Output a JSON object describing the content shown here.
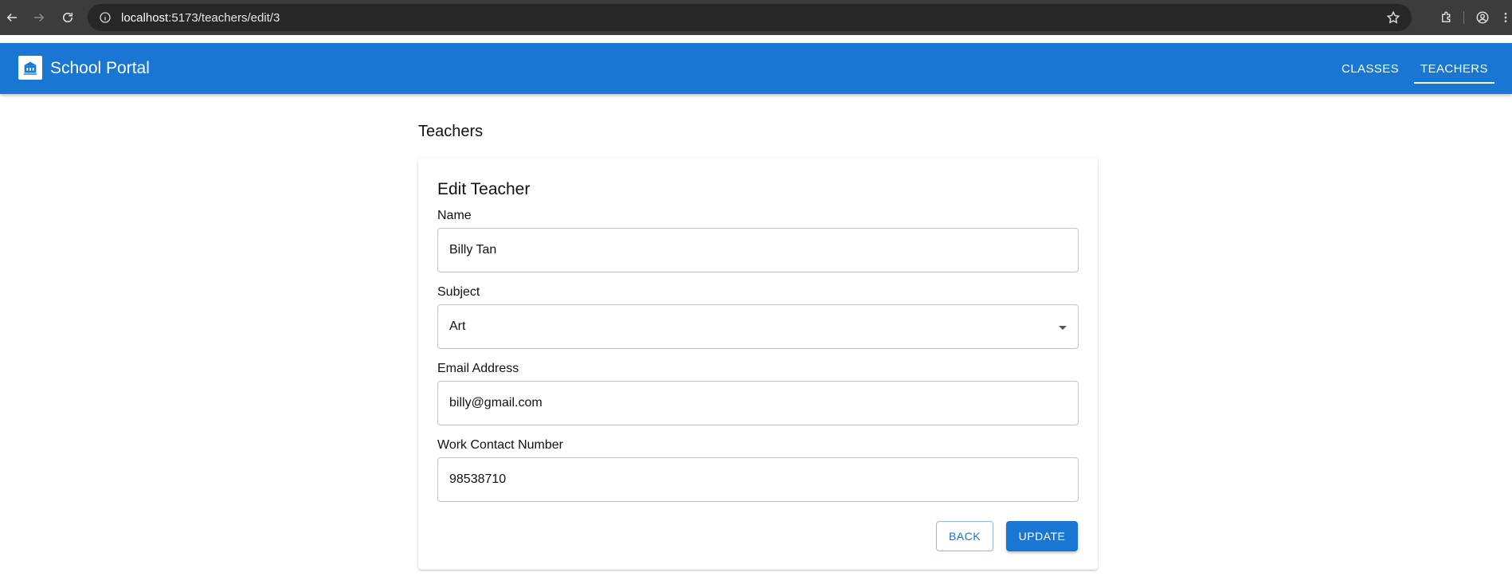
{
  "browser": {
    "url_host": "localhost",
    "url_path": ":5173/teachers/edit/3"
  },
  "app": {
    "brand": "School Portal",
    "nav": {
      "classes": "CLASSES",
      "teachers": "TEACHERS"
    },
    "accent_color": "#1976d2"
  },
  "page": {
    "title": "Teachers"
  },
  "form": {
    "title": "Edit Teacher",
    "name_label": "Name",
    "name_value": "Billy Tan",
    "subject_label": "Subject",
    "subject_value": "Art",
    "email_label": "Email Address",
    "email_value": "billy@gmail.com",
    "contact_label": "Work Contact Number",
    "contact_value": "98538710",
    "back_label": "BACK",
    "update_label": "UPDATE"
  },
  "icons": {
    "back": "arrow-left-icon",
    "forward": "arrow-right-icon",
    "reload": "reload-icon",
    "site_info": "info-icon",
    "bookmark": "star-icon",
    "extensions": "puzzle-icon",
    "profile": "profile-icon",
    "menu": "kebab-menu-icon",
    "logo": "school-logo-icon",
    "subject_dropdown": "caret-down-icon"
  }
}
